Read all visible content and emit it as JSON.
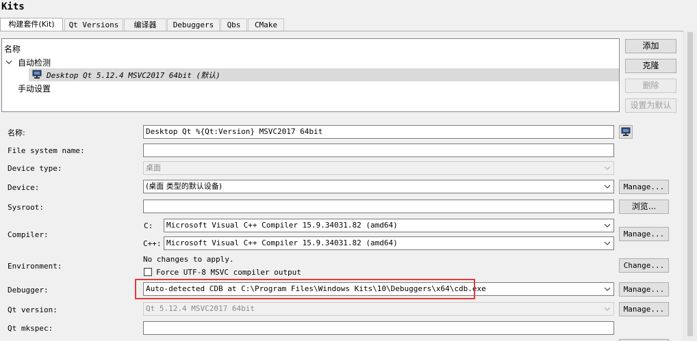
{
  "page": {
    "title": "Kits"
  },
  "tabs": [
    {
      "label": "构建套件(Kit)",
      "active": true
    },
    {
      "label": "Qt Versions",
      "active": false
    },
    {
      "label": "编译器",
      "active": false
    },
    {
      "label": "Debuggers",
      "active": false
    },
    {
      "label": "Qbs",
      "active": false
    },
    {
      "label": "CMake",
      "active": false
    }
  ],
  "tree": {
    "header": "名称",
    "auto_group": "自动检测",
    "kit_name": "Desktop Qt 5.12.4 MSVC2017 64bit (默认)",
    "manual_group": "手动设置"
  },
  "side_buttons": {
    "add": "添加",
    "clone": "克隆",
    "delete": "删除",
    "set_default": "设置为默认"
  },
  "form": {
    "name_label": "名称:",
    "name_value": "Desktop Qt %{Qt:Version} MSVC2017 64bit",
    "fsname_label": "File system name:",
    "fsname_value": "",
    "device_type_label": "Device type:",
    "device_type_value": "桌面",
    "device_label": "Device:",
    "device_value": "(桌面 类型的默认设备)",
    "device_manage": "Manage...",
    "sysroot_label": "Sysroot:",
    "sysroot_value": "",
    "sysroot_browse": "浏览...",
    "compiler_label": "Compiler:",
    "compiler_c_label": "C:",
    "compiler_c_value": "Microsoft Visual C++ Compiler 15.9.34031.82 (amd64)",
    "compiler_cpp_label": "C++:",
    "compiler_cpp_value": "Microsoft Visual C++ Compiler 15.9.34031.82 (amd64)",
    "compiler_manage": "Manage...",
    "env_label": "Environment:",
    "env_status": "No changes to apply.",
    "env_checkbox": "Force UTF-8 MSVC compiler output",
    "env_change": "Change...",
    "debugger_label": "Debugger:",
    "debugger_value": "Auto-detected CDB at C:\\Program Files\\Windows Kits\\10\\Debuggers\\x64\\cdb.exe",
    "debugger_manage": "Manage...",
    "qtversion_label": "Qt version:",
    "qtversion_value": "Qt 5.12.4 MSVC2017 64bit",
    "qtversion_manage": "Manage...",
    "mkspec_label": "Qt mkspec:",
    "mkspec_value": ""
  },
  "colors": {
    "highlight_border": "#e03a3a",
    "selection": "#dadada"
  },
  "icons": [
    "monitor-icon",
    "chevron-down-icon",
    "expand-arrow-icon"
  ]
}
